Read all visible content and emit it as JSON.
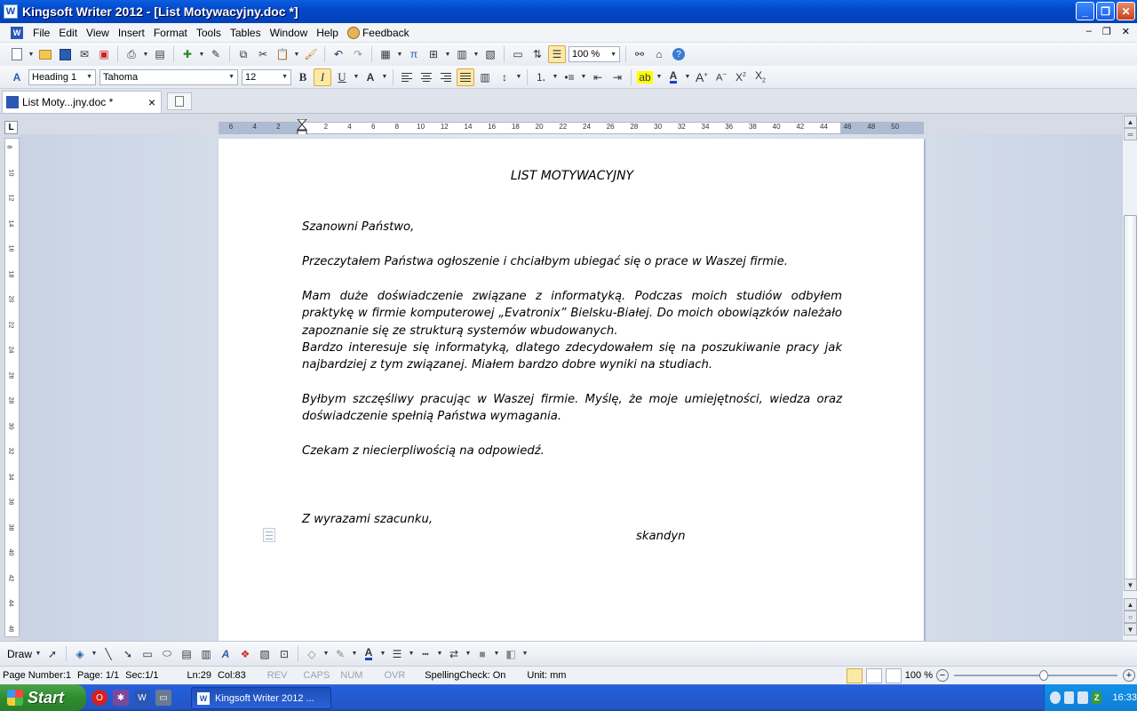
{
  "window": {
    "title": "Kingsoft Writer 2012 - [List Motywacyjny.doc *]",
    "app_icon_letter": "W"
  },
  "menu": {
    "items": [
      "File",
      "Edit",
      "View",
      "Insert",
      "Format",
      "Tools",
      "Tables",
      "Window",
      "Help"
    ],
    "feedback": "Feedback"
  },
  "toolbar": {
    "zoom": "100 %",
    "style": "Heading 1",
    "font": "Tahoma",
    "size": "12",
    "bold": "B",
    "italic": "I",
    "underline": "U"
  },
  "tabs": {
    "active_label": "List Moty...jny.doc *",
    "close": "×"
  },
  "ruler": {
    "corner": "L",
    "top_ticks": [
      "6",
      "4",
      "2",
      "",
      "2",
      "4",
      "6",
      "8",
      "10",
      "12",
      "14",
      "16",
      "18",
      "20",
      "22",
      "24",
      "26",
      "28",
      "30",
      "32",
      "34",
      "36",
      "38",
      "40",
      "42",
      "44",
      "46",
      "48",
      "50"
    ],
    "left_ticks": [
      "8",
      "10",
      "12",
      "14",
      "16",
      "18",
      "20",
      "22",
      "24",
      "26",
      "28",
      "30",
      "32",
      "34",
      "36",
      "38",
      "40",
      "42",
      "44",
      "46"
    ]
  },
  "document": {
    "title": "LIST MOTYWACYJNY",
    "greeting": "Szanowni Państwo,",
    "para1": "Przeczytałem Państwa ogłoszenie i chciałbym ubiegać się o prace w Waszej firmie.",
    "para2a": "Mam duże doświadczenie związane z informatyką. Podczas moich studiów odbyłem praktykę w firmie komputerowej „Evatronix” Bielsku-Białej. Do moich obowiązków należało zapoznanie się ze strukturą systemów wbudowanych.",
    "para2b": "Bardzo interesuje się informatyką, dlatego zdecydowałem się na poszukiwanie pracy jak najbardziej z tym związanej. Miałem bardzo dobre wyniki na studiach.",
    "para3": "Byłbym szczęśliwy pracując w Waszej firmie. Myślę, że moje umiejętności, wiedza oraz doświadczenie spełnią Państwa wymagania.",
    "para4": "Czekam z niecierpliwością na odpowiedź.",
    "closing": "Z wyrazami szacunku,",
    "signature": "skandyn"
  },
  "drawbar": {
    "label": "Draw"
  },
  "status": {
    "page_number": "Page Number:1",
    "page": "Page: 1/1",
    "sec": "Sec:1/1",
    "ln": "Ln:29",
    "col": "Col:83",
    "rev": "REV",
    "caps": "CAPS",
    "num": "NUM",
    "ovr": "OVR",
    "spelling": "SpellingCheck: On",
    "unit": "Unit: mm",
    "zoom": "100 %",
    "zoom_minus": "−",
    "zoom_plus": "+"
  },
  "taskbar": {
    "start": "Start",
    "task_label": "Kingsoft Writer 2012 ...",
    "clock": "16:33"
  },
  "colors": {
    "titlebar": "#0348c9",
    "taskbar": "#245edb",
    "start": "#2e8d2e",
    "tray": "#0f7fd6"
  }
}
